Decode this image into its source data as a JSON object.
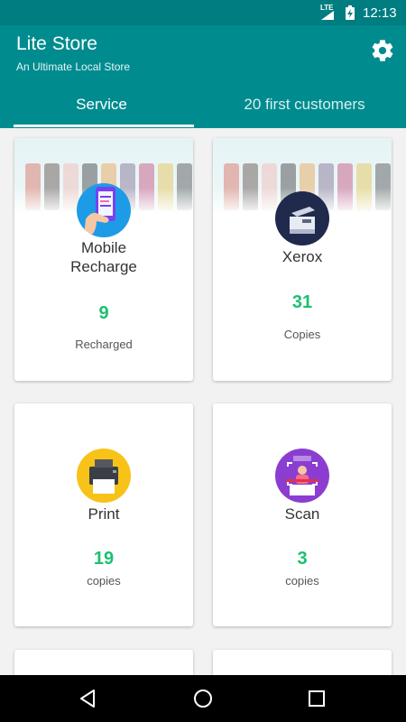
{
  "status_bar": {
    "network": "LTE",
    "time": "12:13"
  },
  "app_bar": {
    "title": "Lite Store",
    "subtitle": "An Ultimate Local Store",
    "settings_icon": "gear-icon"
  },
  "tabs": [
    {
      "label": "Service",
      "selected": true
    },
    {
      "label": "20 first customers",
      "selected": false
    }
  ],
  "services": [
    {
      "label_line1": "Mobile",
      "label_line2": "Recharge",
      "count": "9",
      "unit": "Recharged",
      "icon": "mobile-recharge-icon"
    },
    {
      "label_line1": "Xerox",
      "count": "31",
      "unit": "Copies",
      "icon": "xerox-icon"
    },
    {
      "label_line1": "Print",
      "count": "19",
      "unit": "copies",
      "icon": "printer-icon"
    },
    {
      "label_line1": "Scan",
      "count": "3",
      "unit": "copies",
      "icon": "scan-icon"
    }
  ],
  "colors": {
    "app_bar": "#008c8f",
    "status_bar": "#007d80",
    "count": "#1dbf73"
  }
}
